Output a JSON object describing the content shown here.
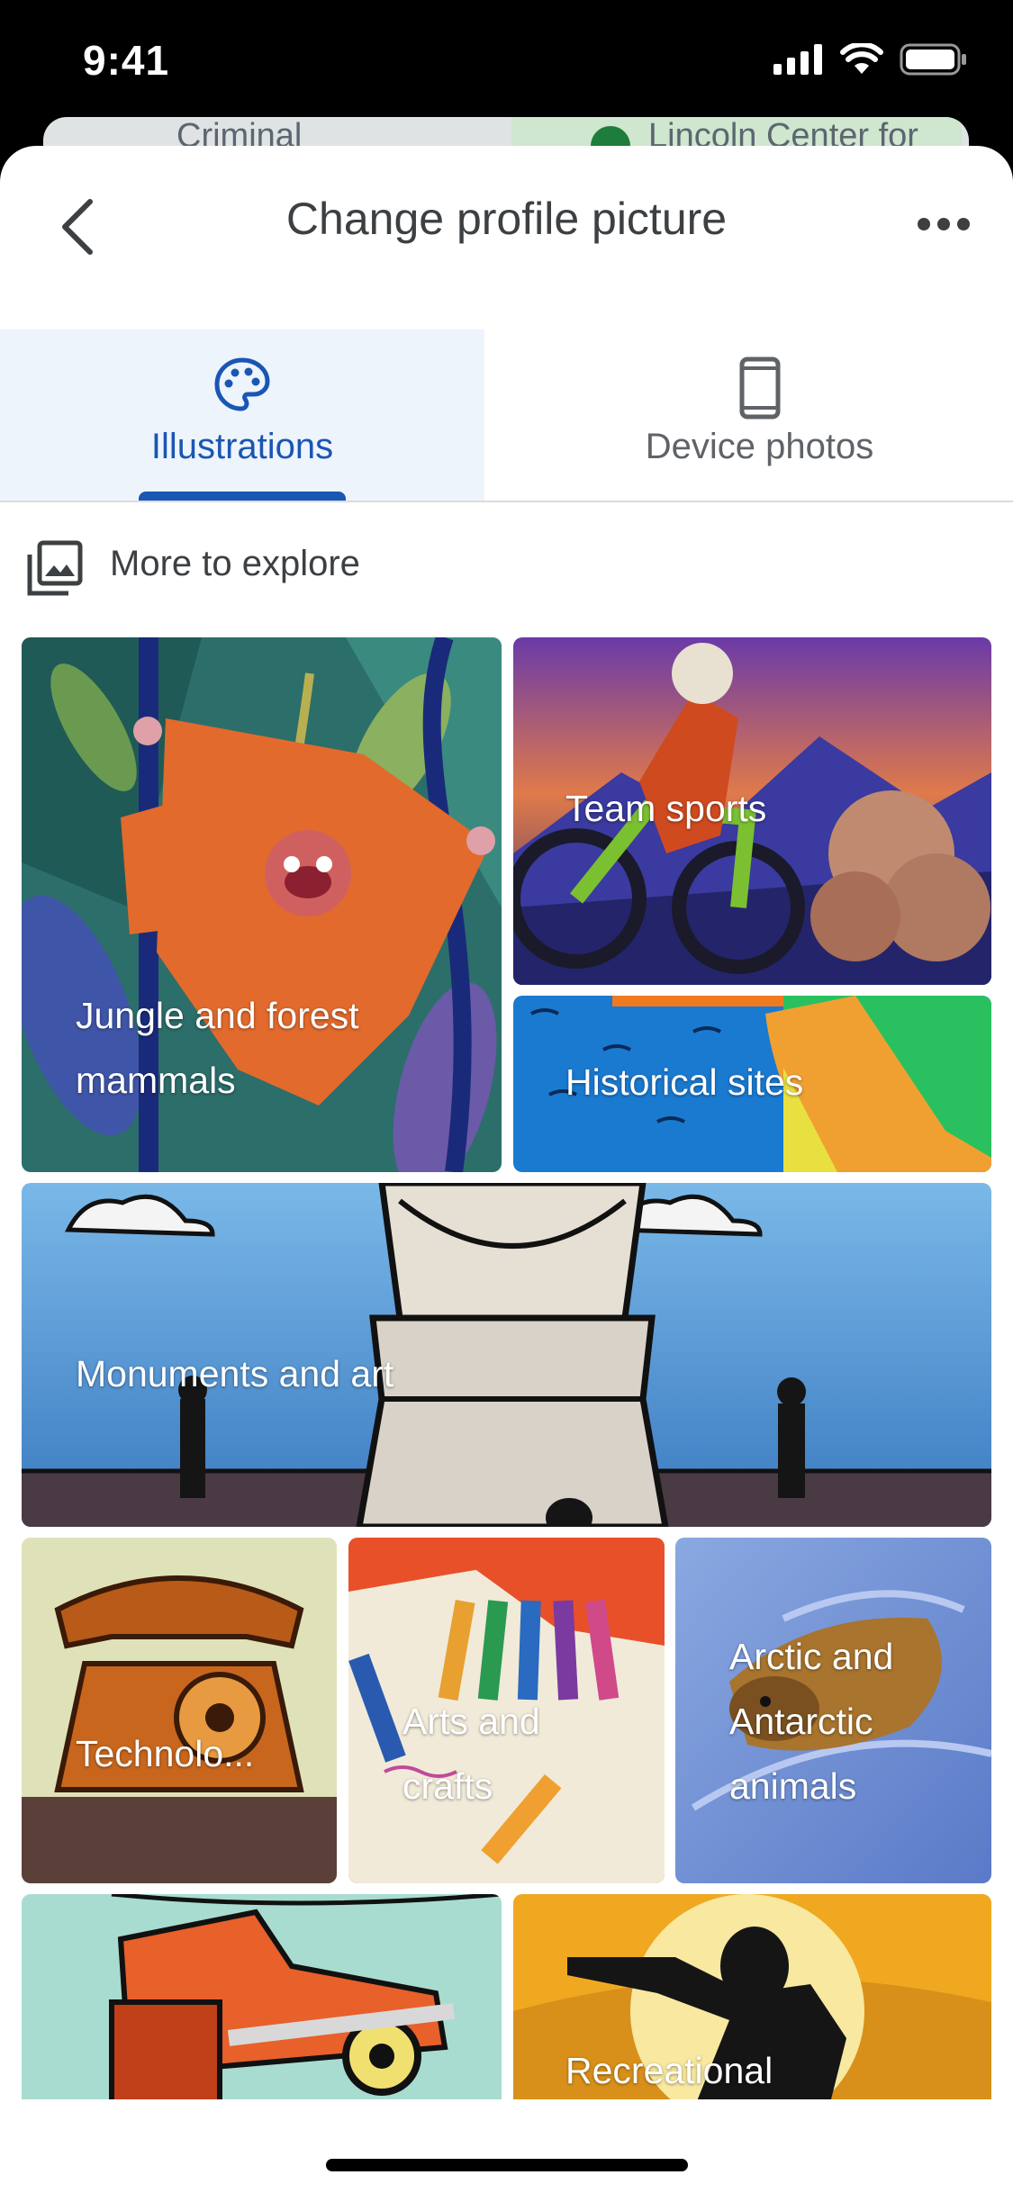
{
  "status_bar": {
    "time": "9:41"
  },
  "map_peek": {
    "street_left": "Criminal",
    "street_right": "Lincoln Center for"
  },
  "header": {
    "title": "Change profile picture"
  },
  "tabs": [
    {
      "label": "Illustrations",
      "selected": true,
      "icon": "palette-icon"
    },
    {
      "label": "Device photos",
      "selected": false,
      "icon": "phone-icon"
    }
  ],
  "section": {
    "label": "More to explore",
    "icon": "photo-library-icon"
  },
  "tiles": [
    {
      "label": "Jungle and forest mammals"
    },
    {
      "label": "Team sports"
    },
    {
      "label": "Historical sites"
    },
    {
      "label": "Monuments and art"
    },
    {
      "label": "Technolo..."
    },
    {
      "label": "Arts and crafts"
    },
    {
      "label": "Arctic and Antarctic animals"
    },
    {
      "label": ""
    },
    {
      "label": "Recreational"
    }
  ],
  "colors": {
    "accent": "#1a56b3",
    "tab_selected_bg": "#eef4fc"
  }
}
